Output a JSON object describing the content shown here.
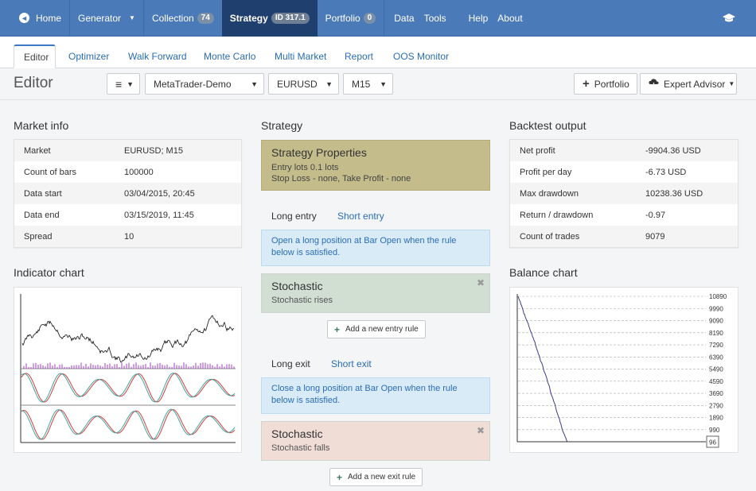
{
  "nav": {
    "home": "Home",
    "generator": "Generator",
    "collection": "Collection",
    "collection_count": "74",
    "strategy": "Strategy",
    "strategy_id": "ID 317.1",
    "portfolio": "Portfolio",
    "portfolio_count": "0",
    "data": "Data",
    "tools": "Tools",
    "help": "Help",
    "about": "About"
  },
  "tabs": [
    "Editor",
    "Optimizer",
    "Walk Forward",
    "Monte Carlo",
    "Multi Market",
    "Report",
    "OOS Monitor"
  ],
  "toolbar": {
    "title": "Editor",
    "menu_icon": "≡",
    "account": "MetaTrader-Demo",
    "symbol": "EURUSD",
    "period": "M15",
    "portfolio_btn": "Portfolio",
    "ea_btn": "Expert Advisor"
  },
  "market_info": {
    "title": "Market info",
    "rows": [
      {
        "k": "Market",
        "v": "EURUSD; M15"
      },
      {
        "k": "Count of bars",
        "v": "100000"
      },
      {
        "k": "Data start",
        "v": "03/04/2015, 20:45"
      },
      {
        "k": "Data end",
        "v": "03/15/2019, 11:45"
      },
      {
        "k": "Spread",
        "v": "10"
      }
    ]
  },
  "indicator_chart": {
    "title": "Indicator chart"
  },
  "strategy": {
    "title": "Strategy",
    "props_title": "Strategy Properties",
    "props_line1": "Entry lots 0.1 lots",
    "props_line2": "Stop Loss - none, Take Profit - none",
    "long_entry": "Long entry",
    "short_entry": "Short entry",
    "entry_hint": "Open a long position at Bar Open when the rule below is satisfied.",
    "entry_rule_name": "Stochastic",
    "entry_rule_desc": "Stochastic rises",
    "add_entry": "Add a new entry rule",
    "long_exit": "Long exit",
    "short_exit": "Short exit",
    "exit_hint": "Close a long position at Bar Open when the rule below is satisfied.",
    "exit_rule_name": "Stochastic",
    "exit_rule_desc": "Stochastic falls",
    "add_exit": "Add a new exit rule"
  },
  "backtest": {
    "title": "Backtest output",
    "rows": [
      {
        "k": "Net profit",
        "v": "-9904.36 USD"
      },
      {
        "k": "Profit per day",
        "v": "-6.73 USD"
      },
      {
        "k": "Max drawdown",
        "v": "10238.36 USD"
      },
      {
        "k": "Return / drawdown",
        "v": "-0.97"
      },
      {
        "k": "Count of trades",
        "v": "9079"
      }
    ]
  },
  "balance_chart": {
    "title": "Balance chart",
    "y_ticks": [
      "10890",
      "9990",
      "9090",
      "8190",
      "7290",
      "6390",
      "5490",
      "4590",
      "3690",
      "2790",
      "1890",
      "990"
    ],
    "last_value": "96"
  },
  "chart_data": {
    "type": "line",
    "title": "Balance chart",
    "ylim": [
      96,
      10890
    ],
    "y_ticks": [
      10890,
      9990,
      9090,
      8190,
      7290,
      6390,
      5490,
      4590,
      3690,
      2790,
      1890,
      990
    ],
    "series": [
      {
        "values": [
          10890,
          10300,
          9600,
          9100,
          8500,
          7900,
          7300,
          6600,
          6000,
          5300,
          4700,
          4000,
          3300,
          2600,
          1900,
          1200,
          600,
          96
        ]
      }
    ]
  },
  "colors": {
    "nav_bg": "#4a7ab8",
    "nav_active": "#1f3f6e",
    "props_bg": "#c4bd8b",
    "entry_rule_bg": "#d1dfd3",
    "exit_rule_bg": "#efddd6",
    "hint_bg": "#d9ebf7",
    "balance_line": "#3b3b8f"
  }
}
